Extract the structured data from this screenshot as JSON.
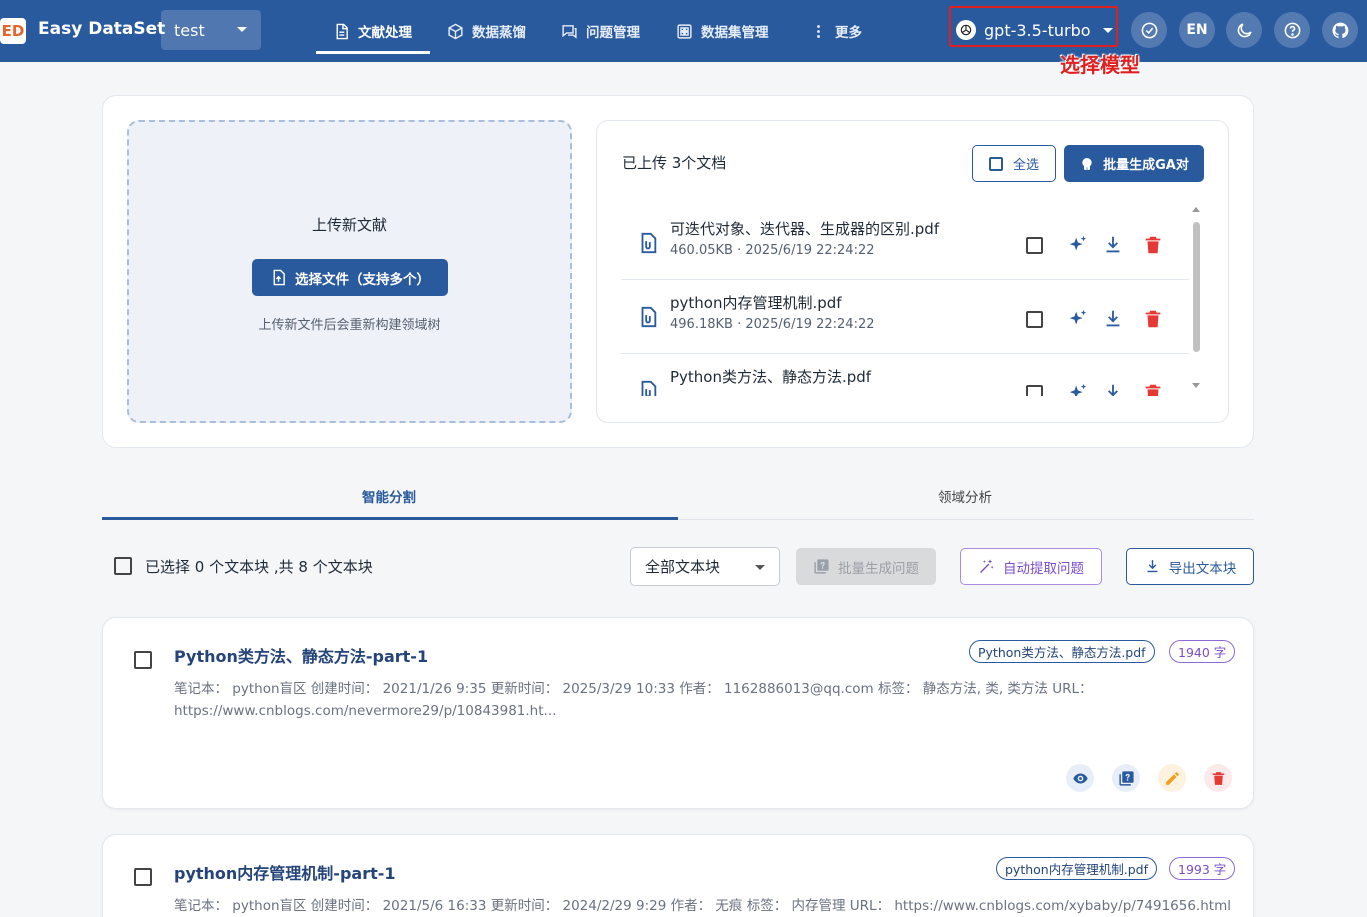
{
  "app": {
    "logo_glyph": "ED",
    "name": "Easy DataSet",
    "project": "test"
  },
  "nav": [
    {
      "label": "文献处理",
      "icon": "document-icon",
      "active": true
    },
    {
      "label": "数据蒸馏",
      "icon": "cube-icon"
    },
    {
      "label": "问题管理",
      "icon": "chat-icon"
    },
    {
      "label": "数据集管理",
      "icon": "grid-icon"
    },
    {
      "label": "更多",
      "icon": "more-vertical-icon"
    }
  ],
  "model": {
    "name": "gpt-3.5-turbo",
    "annotation": "选择模型"
  },
  "header_actions": {
    "language": "EN"
  },
  "upload": {
    "title": "上传新文献",
    "choose_label": "选择文件（支持多个）",
    "hint": "上传新文件后会重新构建领域树"
  },
  "docs": {
    "count_label": "已上传 3个文档",
    "select_all": "全选",
    "batch_qa": "批量生成GA对",
    "items": [
      {
        "name": "可迭代对象、迭代器、生成器的区别.pdf",
        "meta": "460.05KB · 2025/6/19 22:24:22"
      },
      {
        "name": "python内存管理机制.pdf",
        "meta": "496.18KB · 2025/6/19 22:24:22"
      },
      {
        "name": "Python类方法、静态方法.pdf",
        "meta": "—"
      }
    ]
  },
  "tabs": [
    {
      "label": "智能分割",
      "active": true
    },
    {
      "label": "领域分析"
    }
  ],
  "toolbar": {
    "selection_text": "已选择 0 个文本块 ,共 8 个文本块",
    "filter_value": "全部文本块",
    "batch_questions": "批量生成问题",
    "auto_extract": "自动提取问题",
    "export_chunks": "导出文本块"
  },
  "chunks": [
    {
      "title": "Python类方法、静态方法-part-1",
      "file_chip": "Python类方法、静态方法.pdf",
      "count_chip": "1940 字",
      "body": "笔记本： python盲区 创建时间： 2021/1/26 9:35 更新时间： 2025/3/29 10:33 作者： 1162886013@qq.com 标签： 静态方法, 类, 类方法 URL： https://www.cnblogs.com/nevermore29/p/10843981.ht..."
    },
    {
      "title": "python内存管理机制-part-1",
      "file_chip": "python内存管理机制.pdf",
      "count_chip": "1993 字",
      "body": "笔记本： python盲区 创建时间： 2021/5/6 16:33 更新时间： 2024/2/29 9:29 作者： 无痕 标签： 内存管理 URL： https://www.cnblogs.com/xybaby/p/7491656.html"
    }
  ],
  "colors": {
    "primary": "#2a5a9e",
    "danger": "#e53935",
    "annotation": "#e02020",
    "purple": "#7a4ec9",
    "edit": "#f0a020"
  }
}
